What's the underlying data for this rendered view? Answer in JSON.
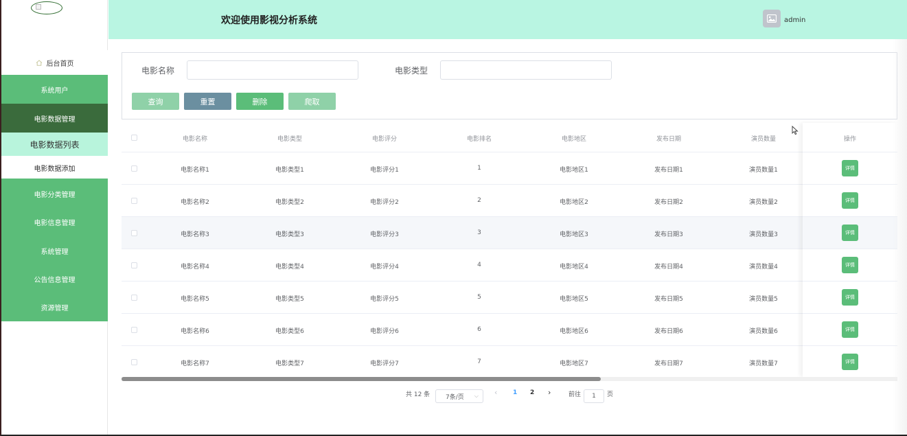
{
  "header": {
    "title": "欢迎使用影视分析系统",
    "username": "admin"
  },
  "sidebar": {
    "home": "后台首页",
    "items": [
      {
        "label": "系统用户"
      },
      {
        "label": "电影数据管理",
        "active": true
      },
      {
        "label": "电影数据列表",
        "sub": true
      },
      {
        "label": "电影数据添加",
        "sub": true
      },
      {
        "label": "电影分类管理"
      },
      {
        "label": "电影信息管理"
      },
      {
        "label": "系统管理"
      },
      {
        "label": "公告信息管理"
      },
      {
        "label": "资源管理"
      }
    ]
  },
  "search": {
    "name_label": "电影名称",
    "name_value": "",
    "type_label": "电影类型",
    "type_value": "",
    "buttons": {
      "query": "查询",
      "reset": "重置",
      "delete": "删除",
      "crawl": "爬取"
    }
  },
  "table": {
    "headers": [
      "电影名称",
      "电影类型",
      "电影评分",
      "电影排名",
      "电影地区",
      "发布日期",
      "演员数量",
      "操作"
    ],
    "rows": [
      [
        "电影名称1",
        "电影类型1",
        "电影评分1",
        "1",
        "电影地区1",
        "发布日期1",
        "演员数量1"
      ],
      [
        "电影名称2",
        "电影类型2",
        "电影评分2",
        "2",
        "电影地区2",
        "发布日期2",
        "演员数量2"
      ],
      [
        "电影名称3",
        "电影类型3",
        "电影评分3",
        "3",
        "电影地区3",
        "发布日期3",
        "演员数量3"
      ],
      [
        "电影名称4",
        "电影类型4",
        "电影评分4",
        "4",
        "电影地区4",
        "发布日期4",
        "演员数量4"
      ],
      [
        "电影名称5",
        "电影类型5",
        "电影评分5",
        "5",
        "电影地区5",
        "发布日期5",
        "演员数量5"
      ],
      [
        "电影名称6",
        "电影类型6",
        "电影评分6",
        "6",
        "电影地区6",
        "发布日期6",
        "演员数量6"
      ],
      [
        "电影名称7",
        "电影类型7",
        "电影评分7",
        "7",
        "电影地区7",
        "发布日期7",
        "演员数量7"
      ]
    ],
    "detail_label": "详情"
  },
  "pagination": {
    "total": "共 12 条",
    "page_size": "7条/页",
    "pages": [
      "1",
      "2"
    ],
    "current": "1",
    "goto_label": "前往",
    "goto_value": "1",
    "page_unit": "页"
  },
  "colors": {
    "accent": "#5bbd79",
    "active": "#3a6b3c",
    "header_bg": "#b9f5e2",
    "reset_btn": "#6b8fa0",
    "light_btn": "#8fd1a8"
  }
}
